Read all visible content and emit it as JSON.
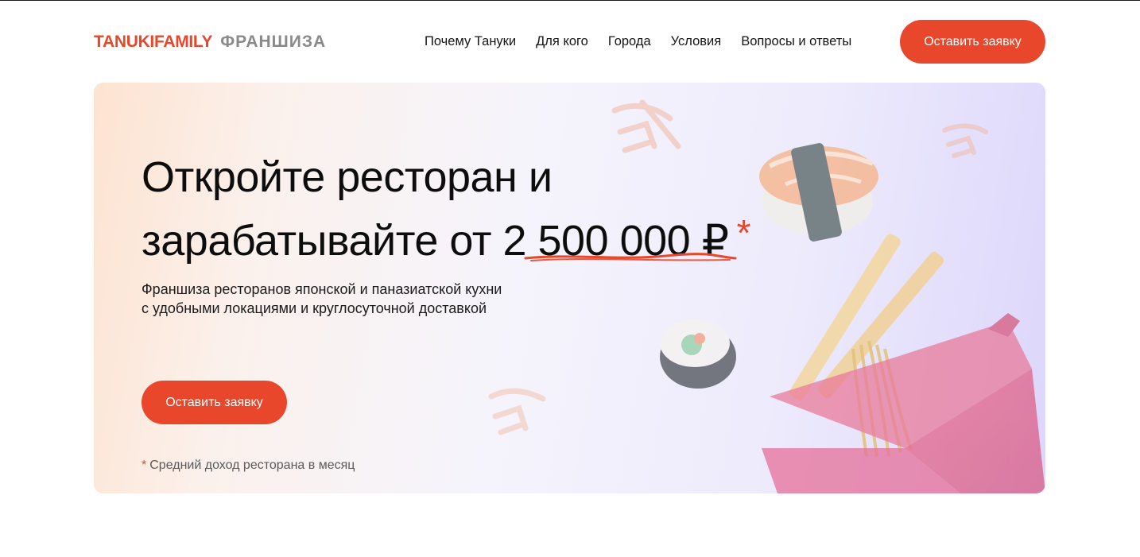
{
  "header": {
    "logo_brand": "TANUKIFAMILY",
    "logo_suffix": "ФРАНШИЗА",
    "nav": [
      {
        "label": "Почему Тануки"
      },
      {
        "label": "Для кого"
      },
      {
        "label": "Города"
      },
      {
        "label": "Условия"
      },
      {
        "label": "Вопросы и ответы"
      }
    ],
    "cta_label": "Оставить заявку"
  },
  "hero": {
    "title_line1": "Откройте ресторан и",
    "title_line2_prefix": "зарабатывайте от",
    "title_amount": "2 500 000 ₽",
    "title_star": "*",
    "subtitle_line1": "Франшиза ресторанов японской и паназиатской кухни",
    "subtitle_line2": "с удобными локациями и круглосуточной доставкой",
    "cta_label": "Оставить заявку",
    "footnote_mark": "*",
    "footnote_text": "Средний доход ресторана в месяц"
  },
  "colors": {
    "accent": "#e8472b",
    "text": "#111111",
    "muted": "#5a5a5a",
    "logo_suffix": "#8a8a8a"
  },
  "icons": {
    "hero_art": [
      "sushi-nigiri-icon",
      "sushi-roll-icon",
      "noodle-box-icon",
      "chopsticks-icon",
      "japanese-pattern-icon"
    ]
  }
}
